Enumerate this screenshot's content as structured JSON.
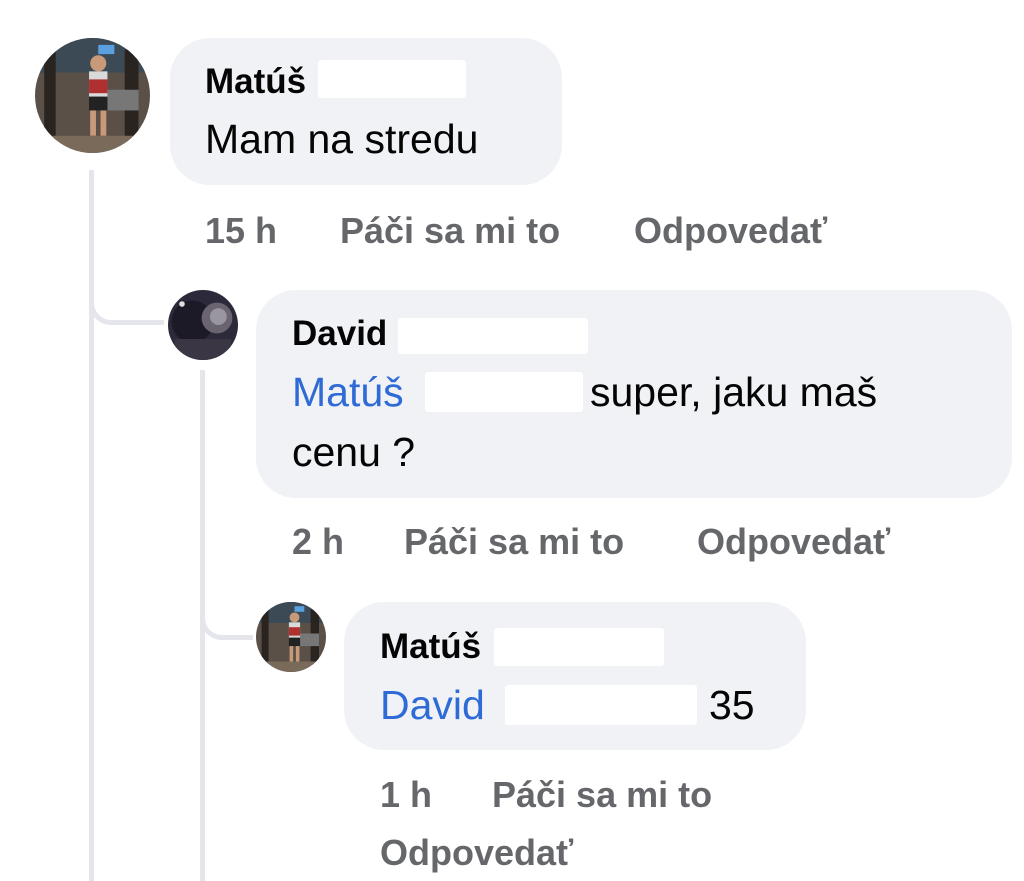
{
  "comments": [
    {
      "author": "Matúš",
      "text": "Mam na stredu",
      "time": "15 h",
      "like_label": "Páči sa mi to",
      "reply_label": "Odpovedať"
    },
    {
      "author": "David",
      "mention": "Matúš",
      "text_line1": "super, jaku maš",
      "text_line2": "cenu ?",
      "time": "2 h",
      "like_label": "Páči sa mi to",
      "reply_label": "Odpovedať"
    },
    {
      "author": "Matúš",
      "mention": "David",
      "text": "35",
      "time": "1 h",
      "like_label": "Páči sa mi to",
      "reply_label": "Odpovedať"
    }
  ],
  "colors": {
    "bubble": "#f0f2f5",
    "mention": "#2f6bd6",
    "meta": "#65676b",
    "thread_line": "#e4e6eb"
  }
}
